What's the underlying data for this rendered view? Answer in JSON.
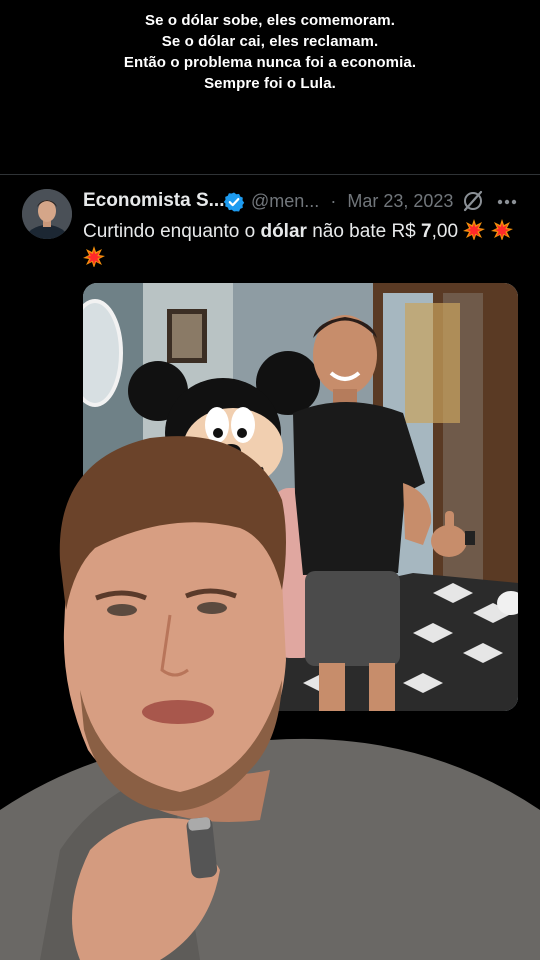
{
  "caption": {
    "lines": [
      "Se o dólar sobe, eles comemoram.",
      "Se o dólar cai, eles reclamam.",
      "Então o problema nunca foi a economia.",
      "Sempre foi o Lula."
    ]
  },
  "tweet": {
    "author_name": "Economista S...",
    "handle": "@men...",
    "separator": "·",
    "date": "Mar 23, 2023",
    "text_part1": "Curtindo enquanto o ",
    "text_bold1": "dólar",
    "text_part2": " não bate R$ ",
    "text_bold2": "7",
    "text_part3": ",00",
    "icons": [
      "verified-badge-icon",
      "grok-icon",
      "more-options-icon",
      "collision-emoji-icon"
    ]
  },
  "colors": {
    "background": "#000000",
    "primary_text": "#e7e9ea",
    "secondary_text": "#71767b",
    "verified_blue": "#1d9bf0",
    "divider": "#2f3336"
  }
}
